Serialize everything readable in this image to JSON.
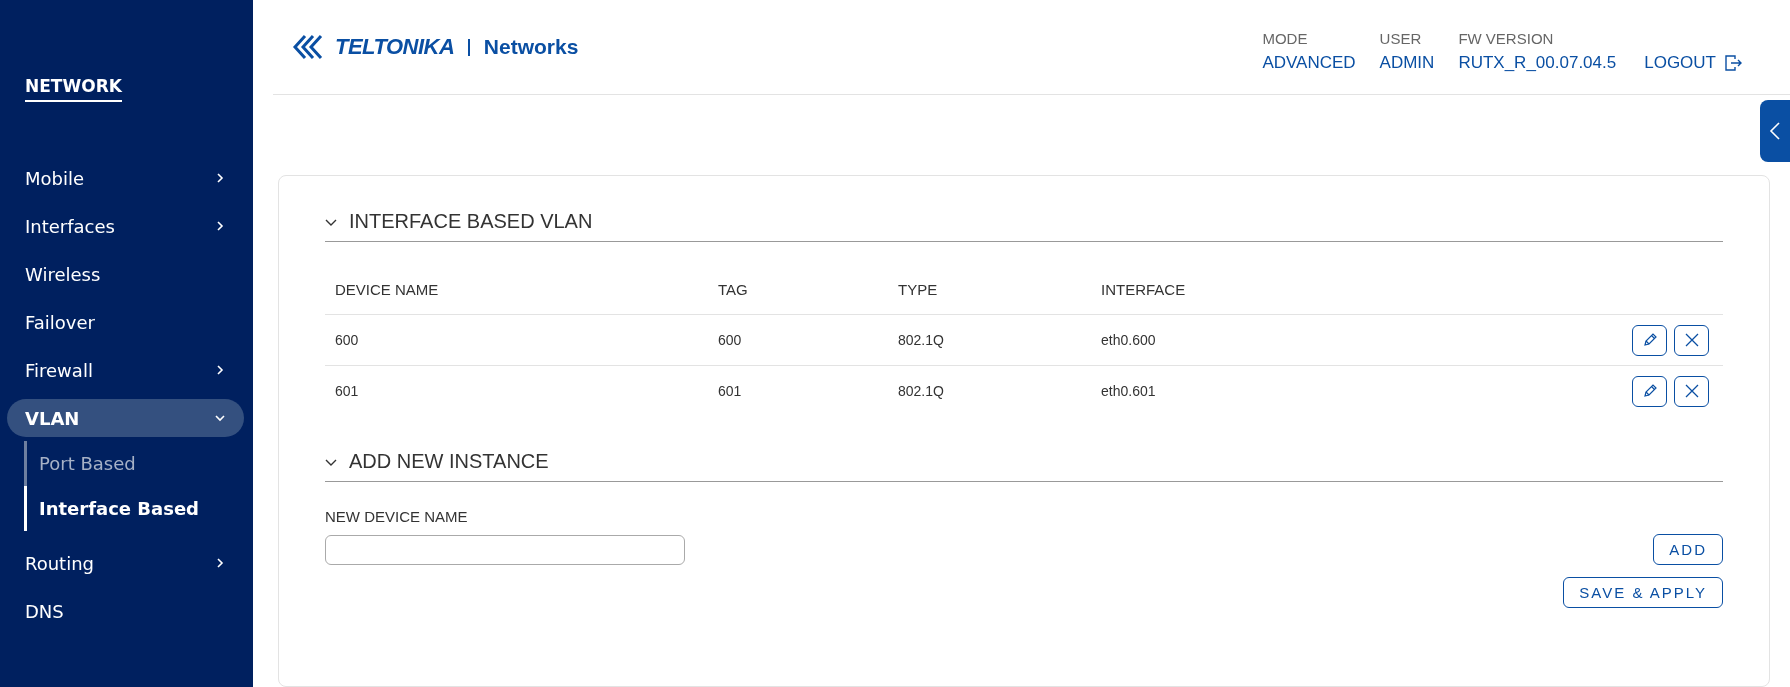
{
  "sidebar": {
    "title": "NETWORK",
    "items": [
      {
        "label": "Mobile",
        "has_submenu": true,
        "expanded": false,
        "selected": false
      },
      {
        "label": "Interfaces",
        "has_submenu": true,
        "expanded": false,
        "selected": false
      },
      {
        "label": "Wireless",
        "has_submenu": false,
        "selected": false
      },
      {
        "label": "Failover",
        "has_submenu": false,
        "selected": false
      },
      {
        "label": "Firewall",
        "has_submenu": true,
        "expanded": false,
        "selected": false
      },
      {
        "label": "VLAN",
        "has_submenu": true,
        "expanded": true,
        "selected": true,
        "children": [
          {
            "label": "Port Based",
            "selected": false
          },
          {
            "label": "Interface Based",
            "selected": true
          }
        ]
      },
      {
        "label": "Routing",
        "has_submenu": true,
        "expanded": false,
        "selected": false
      },
      {
        "label": "DNS",
        "has_submenu": false,
        "selected": false
      }
    ]
  },
  "header": {
    "logo": {
      "brand": "TELTONIKA",
      "product": "Networks"
    },
    "info": [
      {
        "label": "MODE",
        "value": "ADVANCED"
      },
      {
        "label": "USER",
        "value": "ADMIN"
      },
      {
        "label": "FW VERSION",
        "value": "RUTX_R_00.07.04.5"
      }
    ],
    "logout": "LOGOUT"
  },
  "sections": [
    {
      "kind": "table",
      "title": "INTERFACE BASED VLAN",
      "expanded": true,
      "columns": [
        "DEVICE NAME",
        "TAG",
        "TYPE",
        "INTERFACE"
      ],
      "rows": [
        [
          "600",
          "600",
          "802.1Q",
          "eth0.600"
        ],
        [
          "601",
          "601",
          "802.1Q",
          "eth0.601"
        ]
      ]
    },
    {
      "kind": "form",
      "title": "ADD NEW INSTANCE",
      "expanded": true,
      "field": {
        "label": "NEW DEVICE NAME"
      },
      "buttons": [
        "ADD",
        "SAVE & APPLY"
      ]
    }
  ]
}
